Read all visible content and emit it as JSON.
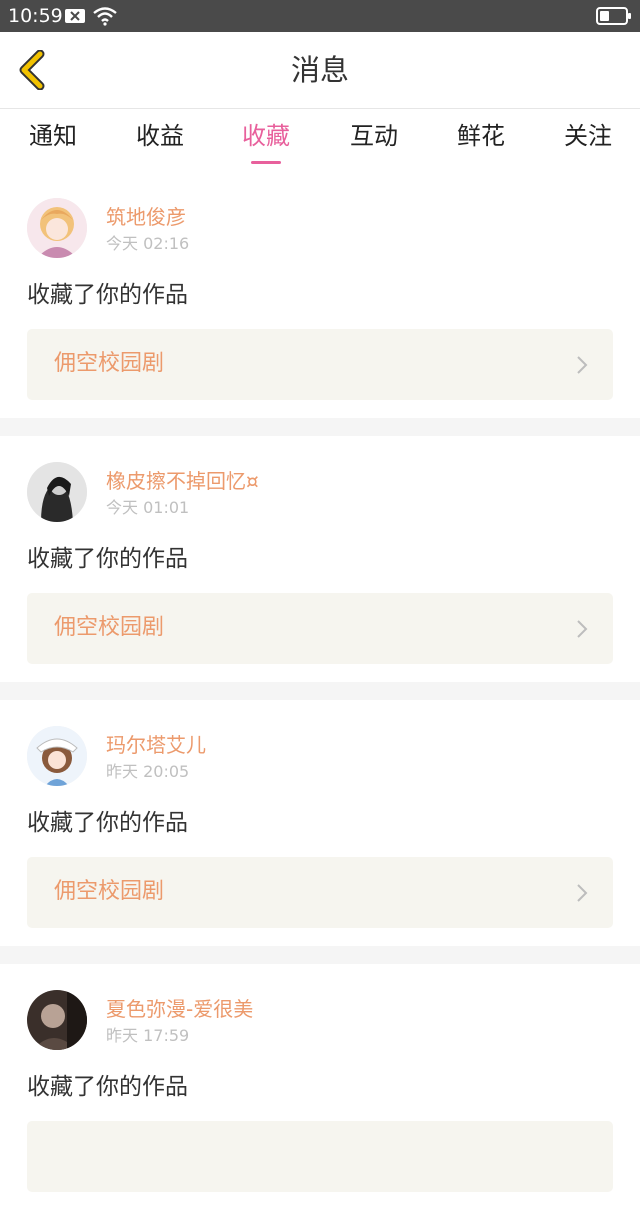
{
  "status_bar": {
    "time": "10:59",
    "icons": [
      "notification-x-icon",
      "wifi-icon",
      "battery-icon"
    ]
  },
  "header": {
    "title": "消息",
    "back_icon": "chevron-left-icon",
    "accent_color": "#f2c200"
  },
  "tabs": [
    {
      "label": "通知"
    },
    {
      "label": "收益"
    },
    {
      "label": "收藏",
      "active": true
    },
    {
      "label": "互动"
    },
    {
      "label": "鲜花"
    },
    {
      "label": "关注"
    }
  ],
  "colors": {
    "active_tab": "#e8609c",
    "username": "#ec9a6c",
    "work_box_bg": "#f6f5ef"
  },
  "messages": [
    {
      "username": "筑地俊彦",
      "time": "今天 02:16",
      "action": "收藏了你的作品",
      "work": "佣空校园剧"
    },
    {
      "username": "橡皮擦不掉回忆¤",
      "time": "今天 01:01",
      "action": "收藏了你的作品",
      "work": "佣空校园剧"
    },
    {
      "username": "玛尔塔艾儿",
      "time": "昨天 20:05",
      "action": "收藏了你的作品",
      "work": "佣空校园剧"
    },
    {
      "username": "夏色弥漫-爱很美",
      "time": "昨天 17:59",
      "action": "收藏了你的作品",
      "work": ""
    }
  ]
}
